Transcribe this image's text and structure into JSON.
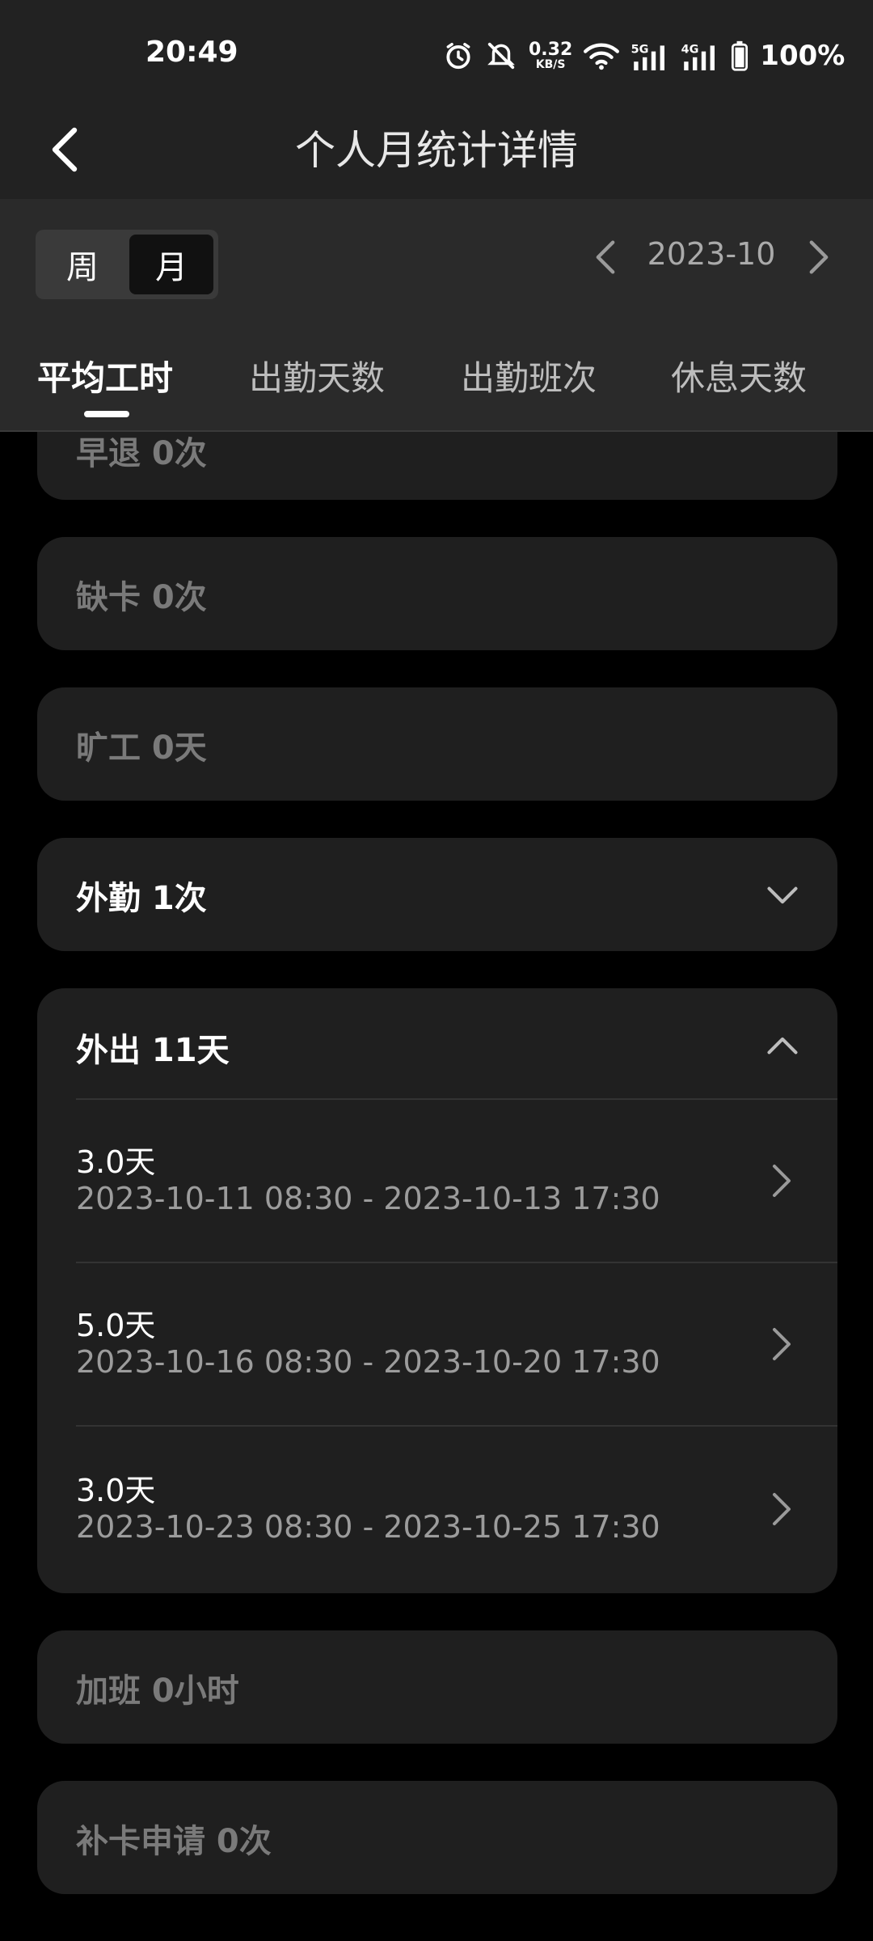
{
  "status_bar": {
    "time": "20:49",
    "net_speed_value": "0.32",
    "net_speed_unit": "KB/S",
    "battery": "100%",
    "icons": [
      "alarm-icon",
      "mute-icon",
      "wifi-icon",
      "5g-signal-icon",
      "4g-signal-icon",
      "battery-icon"
    ]
  },
  "header": {
    "title": "个人月统计详情",
    "back_icon": "back-arrow-icon"
  },
  "period_toggle": {
    "week": "周",
    "month": "月",
    "selected": "month"
  },
  "month_nav": {
    "label": "2023-10"
  },
  "tabs": [
    {
      "label": "平均工时",
      "active": true
    },
    {
      "label": "出勤天数",
      "active": false
    },
    {
      "label": "出勤班次",
      "active": false
    },
    {
      "label": "休息天数",
      "active": false
    }
  ],
  "cards": {
    "early_leave": "早退 0次",
    "missing_punch": "缺卡 0次",
    "absence": "旷工 0天",
    "field_work": "外勤 1次",
    "out": {
      "title": "外出 11天",
      "entries": [
        {
          "days": "3.0天",
          "range": "2023-10-11 08:30 - 2023-10-13 17:30"
        },
        {
          "days": "5.0天",
          "range": "2023-10-16 08:30 - 2023-10-20 17:30"
        },
        {
          "days": "3.0天",
          "range": "2023-10-23 08:30 - 2023-10-25 17:30"
        }
      ]
    },
    "overtime": "加班 0小时",
    "makeup_request": "补卡申请 0次"
  },
  "colors": {
    "background": "#000000",
    "card": "#1f1f1f",
    "header": "#222222",
    "tabbar": "#2a2a2a",
    "muted_text": "#7a7a7a",
    "secondary_text": "#9c9c9c"
  }
}
